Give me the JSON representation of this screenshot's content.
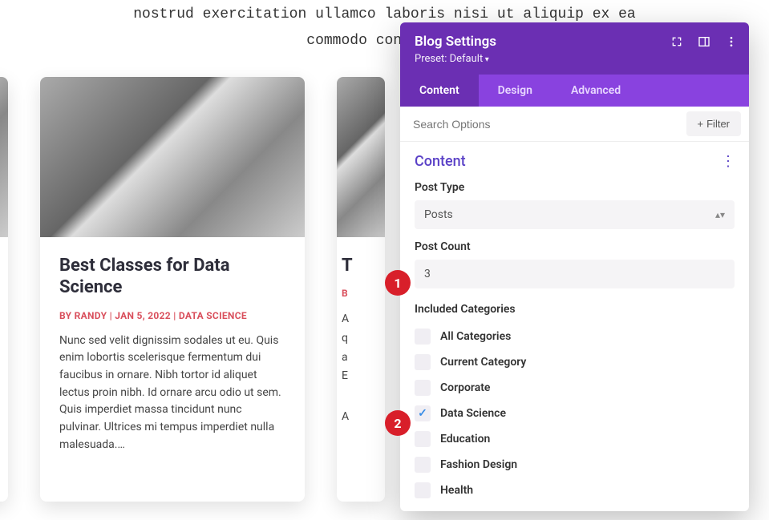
{
  "bg": {
    "line1": "nostrud exercitation ullamco laboris nisi ut aliquip ex ea",
    "line2": "commodo consequat."
  },
  "card": {
    "title": "Best Classes for Data Science",
    "meta": "BY RANDY | JAN 5, 2022 | DATA SCIENCE",
    "excerpt": "Nunc sed velit dignissim sodales ut eu. Quis enim lobortis scelerisque fermentum dui faucibus in ornare. Nibh tortor id aliquet lectus proin nibh. Id ornare arcu odio ut sem. Quis imperdiet massa tincidunt nunc pulvinar. Ultrices mi tempus imperdiet nulla malesuada.…"
  },
  "card2": {
    "title_initial": "T",
    "meta_initial": "B",
    "body_visible": "A\nq\na\nE",
    "footer_initial": "A"
  },
  "panel": {
    "title": "Blog Settings",
    "preset": "Preset: Default",
    "tabs": [
      "Content",
      "Design",
      "Advanced"
    ],
    "search_placeholder": "Search Options",
    "filter_label": "Filter",
    "section_title": "Content",
    "post_type_label": "Post Type",
    "post_type_value": "Posts",
    "post_count_label": "Post Count",
    "post_count_value": "3",
    "included_label": "Included Categories",
    "categories": [
      {
        "label": "All Categories",
        "checked": false
      },
      {
        "label": "Current Category",
        "checked": false
      },
      {
        "label": "Corporate",
        "checked": false
      },
      {
        "label": "Data Science",
        "checked": true
      },
      {
        "label": "Education",
        "checked": false
      },
      {
        "label": "Fashion Design",
        "checked": false
      },
      {
        "label": "Health",
        "checked": false
      }
    ]
  },
  "badges": {
    "one": "1",
    "two": "2"
  }
}
